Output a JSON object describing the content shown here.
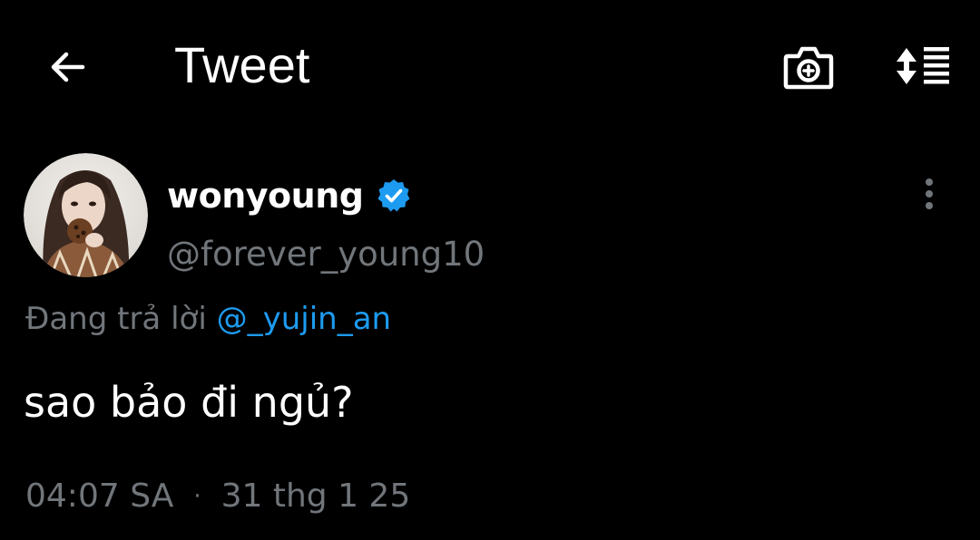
{
  "header": {
    "title": "Tweet",
    "back_icon": "arrow-left-icon",
    "camera_icon": "camera-plus-icon",
    "sort_icon": "sort-lines-icon"
  },
  "tweet": {
    "author": {
      "display_name": "wonyoung",
      "handle": "@forever_young10",
      "verified": true,
      "verified_color": "#1d9bf0"
    },
    "reply_prefix": "Đang trả lời",
    "reply_to": "@_yujin_an",
    "text": "sao bảo đi ngủ?",
    "time": "04:07 SA",
    "separator": "·",
    "date": "31 thg 1 25"
  },
  "colors": {
    "background": "#000000",
    "primary_text": "#ffffff",
    "secondary_text": "#71767b",
    "accent": "#1d9bf0"
  }
}
